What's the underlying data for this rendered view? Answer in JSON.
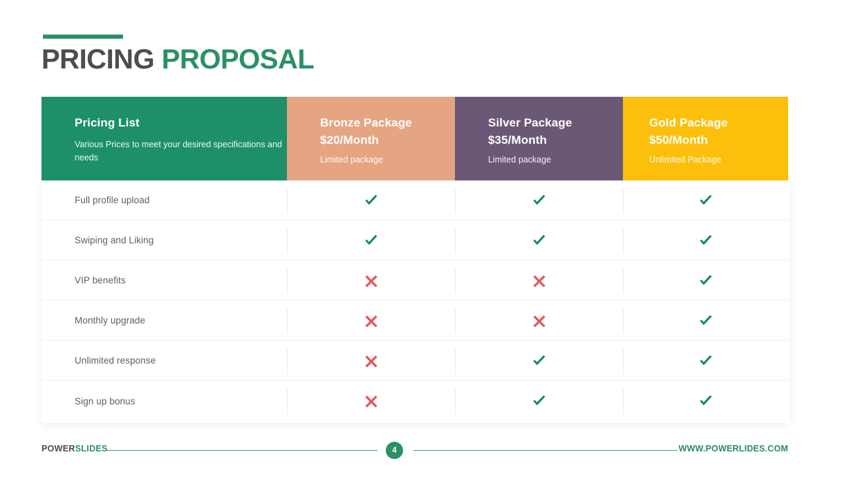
{
  "slide": {
    "title_part1": "PRICING ",
    "title_part2": "PROPOSAL"
  },
  "colors": {
    "green": "#2a9065",
    "header_green": "#1d9069",
    "bronze": "#e5a582",
    "silver": "#6b5876",
    "gold": "#fcc00c",
    "check": "#128a5c",
    "cross": "#e2595c",
    "title_dark": "#4d4d4d",
    "feature_text": "#5a5f66"
  },
  "table": {
    "headers": [
      {
        "title": "Pricing List",
        "subtitle": "Various Prices to meet your desired specifications and needs",
        "type": "pricing"
      },
      {
        "title": "Bronze Package",
        "price": "$20/Month",
        "subtitle": "Limited package",
        "type": "bronze"
      },
      {
        "title": "Silver Package",
        "price": "$35/Month",
        "subtitle": "Limited package",
        "type": "silver"
      },
      {
        "title": "Gold Package",
        "price": "$50/Month",
        "subtitle": "Unlimited Package",
        "type": "gold"
      }
    ],
    "rows": [
      {
        "feature": "Full profile upload",
        "bronze": "check",
        "silver": "check",
        "gold": "check"
      },
      {
        "feature": "Swiping and Liking",
        "bronze": "check",
        "silver": "check",
        "gold": "check"
      },
      {
        "feature": "VIP benefits",
        "bronze": "cross",
        "silver": "cross",
        "gold": "check"
      },
      {
        "feature": "Monthly upgrade",
        "bronze": "cross",
        "silver": "cross",
        "gold": "check"
      },
      {
        "feature": "Unlimited response",
        "bronze": "cross",
        "silver": "check",
        "gold": "check"
      },
      {
        "feature": "Sign up bonus",
        "bronze": "cross",
        "silver": "check",
        "gold": "check"
      }
    ]
  },
  "footer": {
    "brand_part1": "POWER",
    "brand_part2": "SLIDES",
    "page_number": "4",
    "site_url": "WWW.POWERLIDES.COM"
  }
}
